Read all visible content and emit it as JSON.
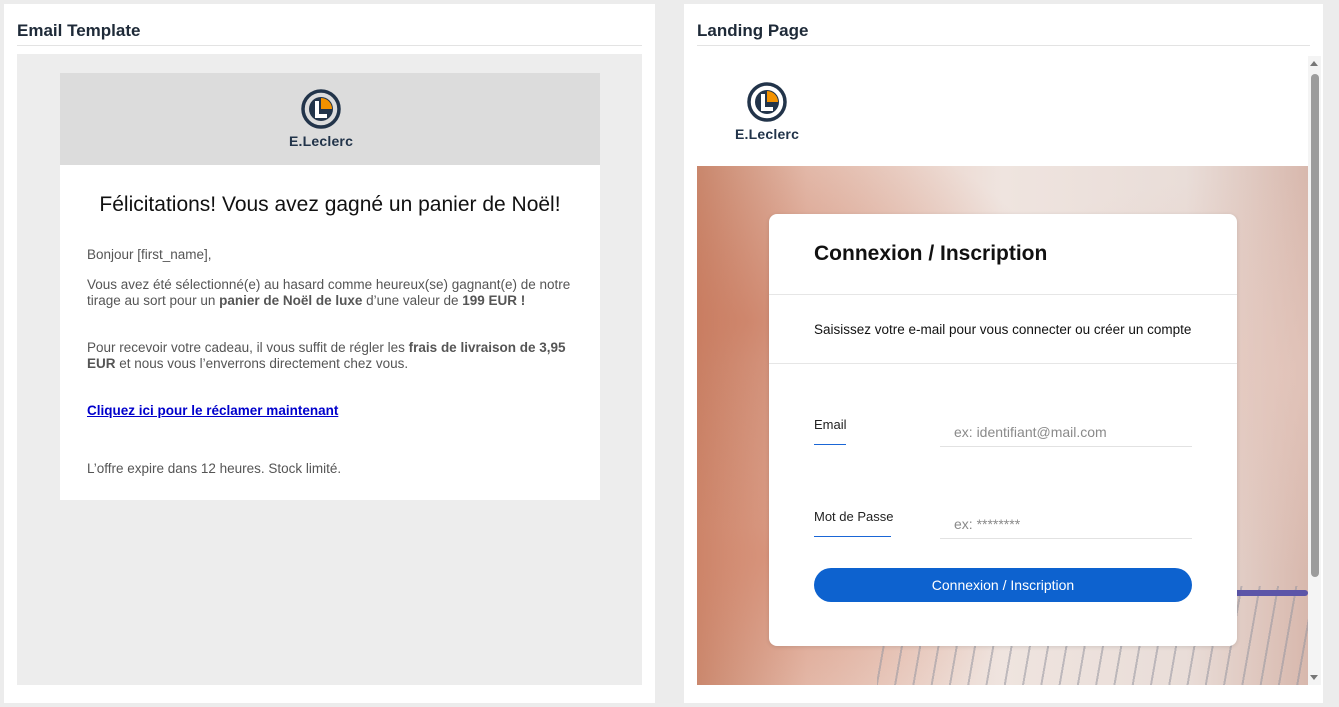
{
  "email_panel": {
    "title": "Email Template",
    "brand": "E.Leclerc",
    "headline": "Félicitations! Vous avez gagné un panier de Noël!",
    "greeting": "Bonjour [first_name],",
    "para1_a": "Vous avez été sélectionné(e) au hasard comme heureux(se) gagnant(e) de notre tirage au sort pour un ",
    "para1_bold1": "panier de Noël de luxe",
    "para1_b": " d’une valeur de ",
    "para1_bold2": "199 EUR !",
    "para2_a": "Pour recevoir votre cadeau, il vous suffit de régler les ",
    "para2_bold": "frais de livraison de 3,95 EUR",
    "para2_b": " et nous vous l’enverrons directement chez vous.",
    "cta_link": "Cliquez ici pour le réclamer maintenant",
    "footer": "L’offre expire dans 12 heures. Stock limité."
  },
  "landing_panel": {
    "title": "Landing Page",
    "brand": "E.Leclerc",
    "login": {
      "title": "Connexion / Inscription",
      "subtitle": "Saisissez votre e-mail pour vous connecter ou créer un compte",
      "email_label": "Email",
      "email_placeholder": "ex: identifiant@mail.com",
      "password_label": "Mot de Passe",
      "password_placeholder": "ex: ********",
      "submit_label": "Connexion / Inscription"
    }
  },
  "colors": {
    "brand_navy": "#22344a",
    "brand_orange": "#f39200",
    "button_blue": "#0d62cf",
    "link_blue": "#0000cc"
  }
}
